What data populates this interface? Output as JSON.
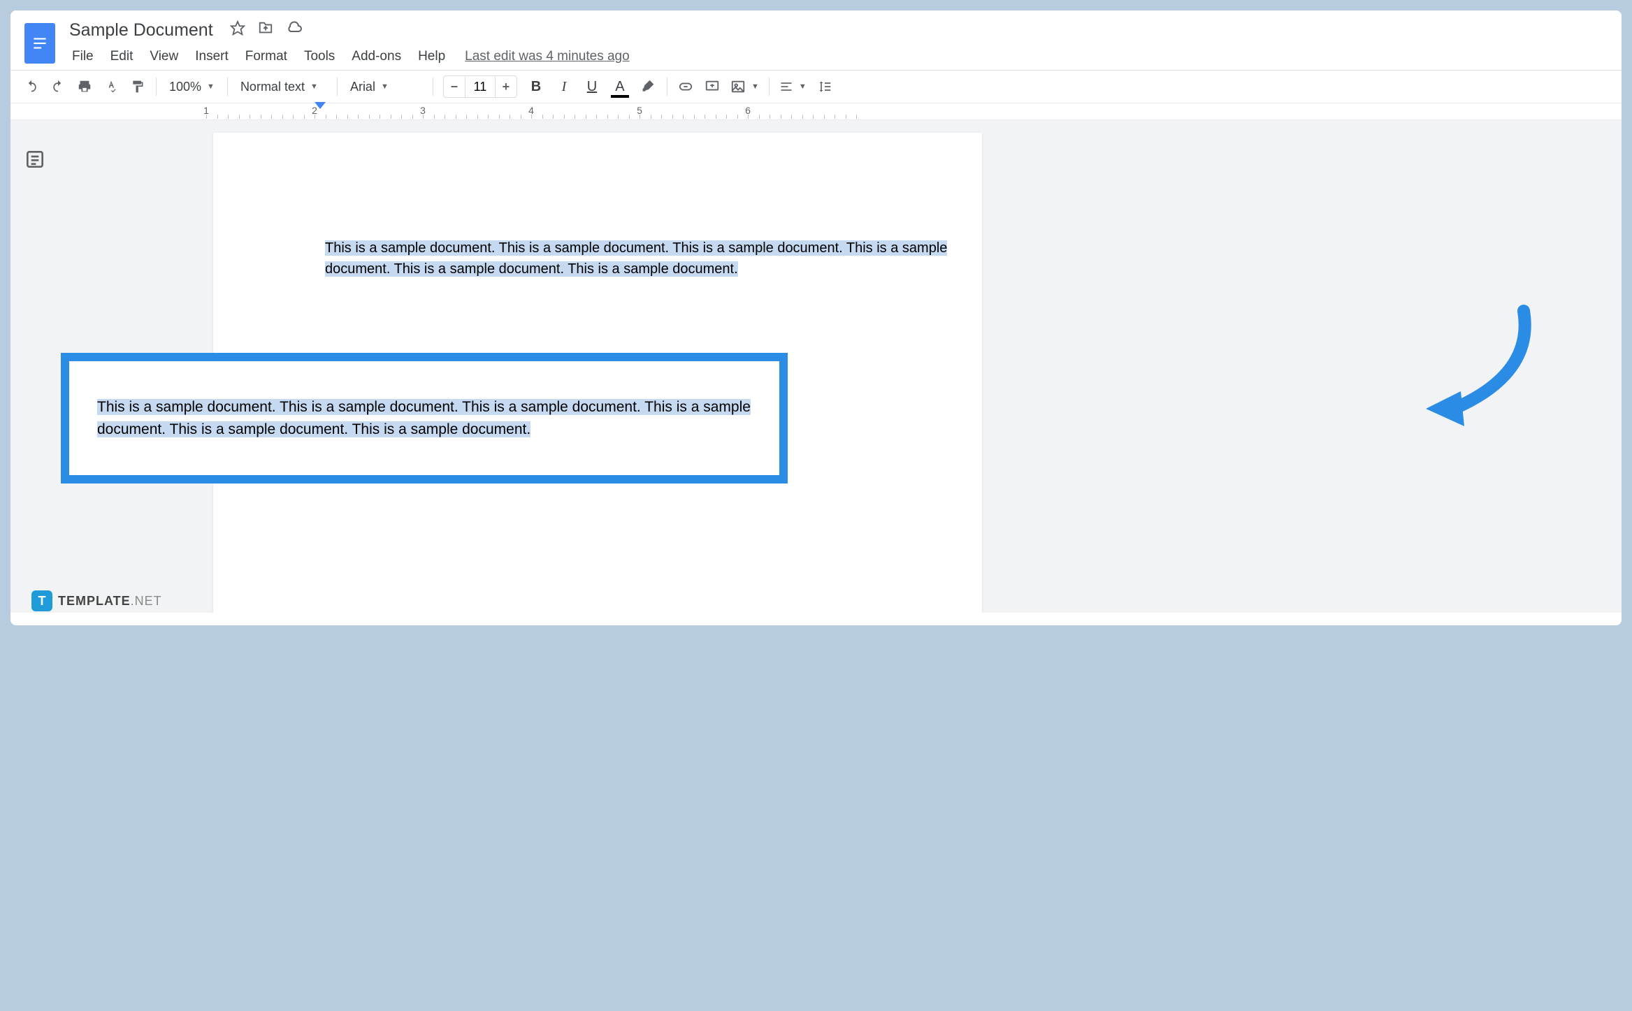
{
  "document": {
    "title": "Sample Document",
    "last_edit": "Last edit was 4 minutes ago"
  },
  "menus": {
    "file": "File",
    "edit": "Edit",
    "view": "View",
    "insert": "Insert",
    "format": "Format",
    "tools": "Tools",
    "addons": "Add-ons",
    "help": "Help"
  },
  "toolbar": {
    "zoom": "100%",
    "style": "Normal text",
    "font": "Arial",
    "font_size": "11"
  },
  "ruler": {
    "marks": [
      "1",
      "2",
      "3",
      "4",
      "5",
      "6"
    ]
  },
  "content": {
    "paragraph": "This is a sample document. This is a sample document. This is a sample document. This is a sample document. This is a sample document. This is a sample document."
  },
  "watermark": {
    "brand": "TEMPLATE",
    "suffix": ".NET"
  }
}
